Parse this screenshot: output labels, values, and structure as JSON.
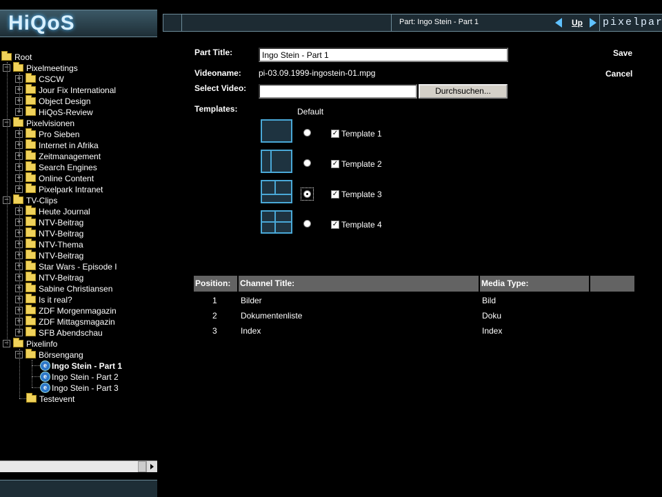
{
  "header": {
    "logo": "HiQoS",
    "title": "Part: Ingo Stein - Part 1",
    "up_label": "Up",
    "brand": "pixelpar"
  },
  "tree": {
    "root": "Root",
    "pixelmeetings": "Pixelmeetings",
    "cscw": "CSCW",
    "jour_fix": "Jour Fix International",
    "object_design": "Object Design",
    "hiqos_review": "HiQoS-Review",
    "pixelvisionen": "Pixelvisionen",
    "pro_sieben": "Pro Sieben",
    "internet_afrika": "Internet in Afrika",
    "zeitmanagement": "Zeitmanagement",
    "search_engines": "Search Engines",
    "online_content": "Online Content",
    "pixelpark_intranet": "Pixelpark Intranet",
    "tv_clips": "TV-Clips",
    "heute_journal": "Heute Journal",
    "ntv1": "NTV-Beitrag",
    "ntv2": "NTV-Beitrag",
    "ntv_thema": "NTV-Thema",
    "ntv3": "NTV-Beitrag",
    "star_wars": "Star Wars - Episode I",
    "ntv4": "NTV-Beitrag",
    "sabine": "Sabine Christiansen",
    "is_it_real": "Is it real?",
    "zdf_morgen": "ZDF Morgenmagazin",
    "zdf_mittag": "ZDF Mittagsmagazin",
    "sfb": "SFB Abendschau",
    "pixelinfo": "Pixelinfo",
    "boersengang": "Börsengang",
    "part1": "Ingo Stein - Part 1",
    "part2": "Ingo Stein - Part 2",
    "part3": "Ingo Stein - Part 3",
    "testevent": "Testevent"
  },
  "form": {
    "part_title_label": "Part Title:",
    "part_title_value": "Ingo Stein - Part 1",
    "videoname_label": "Videoname:",
    "videoname_value": "pi-03.09.1999-ingostein-01.mpg",
    "select_video_label": "Select Video:",
    "select_video_value": "",
    "browse_label": "Durchsuchen...",
    "templates_label": "Templates:",
    "default_label": "Default",
    "save_label": "Save",
    "cancel_label": "Cancel",
    "templates": [
      {
        "label": "Template 1",
        "default": false,
        "checked": true
      },
      {
        "label": "Template 2",
        "default": false,
        "checked": true
      },
      {
        "label": "Template 3",
        "default": true,
        "checked": true
      },
      {
        "label": "Template 4",
        "default": false,
        "checked": true
      }
    ]
  },
  "table": {
    "headers": [
      "Position:",
      "Channel Title:",
      "Media Type:",
      ""
    ],
    "rows": [
      {
        "position": "1",
        "title": "Bilder",
        "type": "Bild"
      },
      {
        "position": "2",
        "title": "Dokumentenliste",
        "type": "Doku"
      },
      {
        "position": "3",
        "title": "Index",
        "type": "Index"
      }
    ]
  }
}
